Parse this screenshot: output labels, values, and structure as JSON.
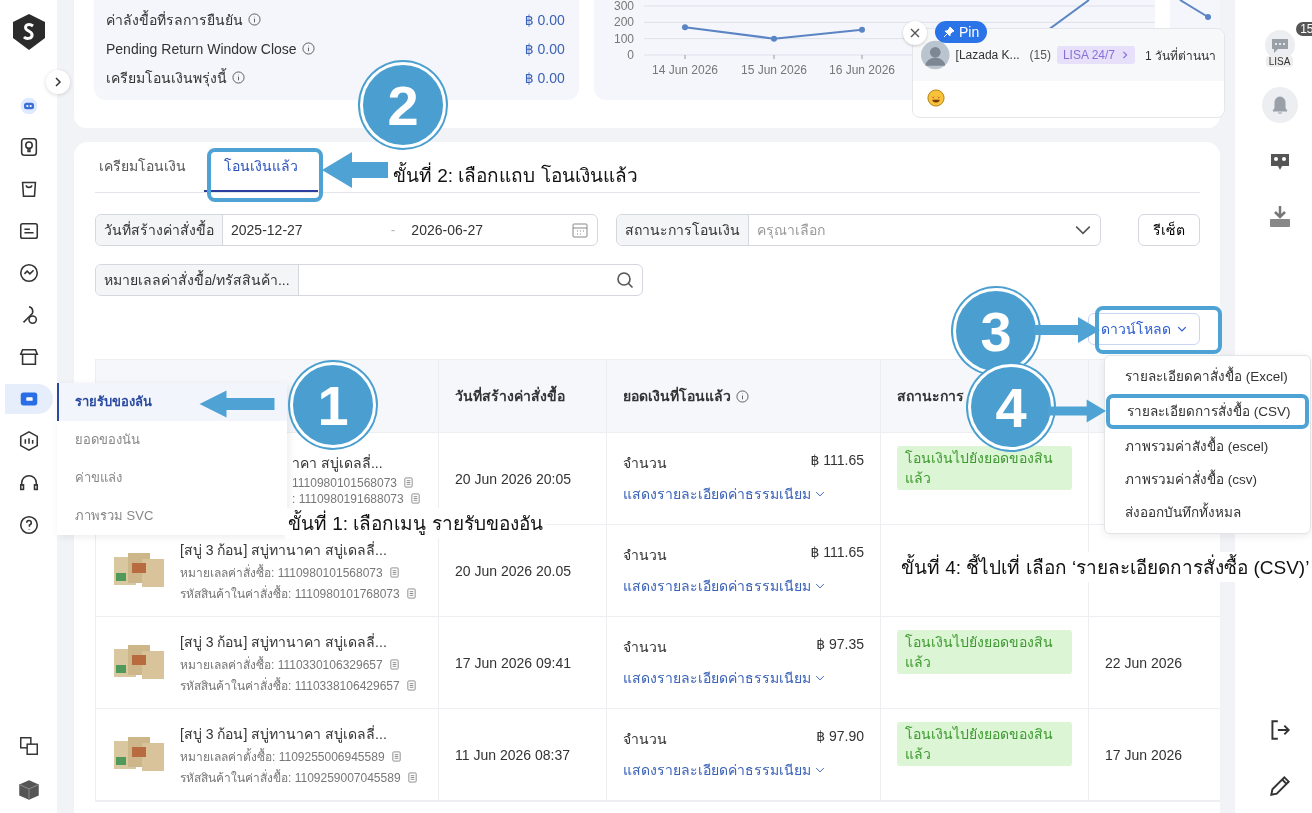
{
  "summary": [
    {
      "label": "ค่าลังขื้อที่รลการยืนยัน",
      "value": "฿ 0.00"
    },
    {
      "label": "Pending Return Window Close",
      "value": "฿ 0.00"
    },
    {
      "label": "เครียมโอนเงินพรุ่งนี้",
      "value": "฿ 0.00"
    }
  ],
  "chart": {
    "chart_data": {
      "type": "line",
      "x": [
        "14 Jun 2026",
        "15 Jun 2026",
        "16 Jun 2026"
      ],
      "series": [
        {
          "color": "#5b84c4",
          "marker": true,
          "values": [
            170,
            100,
            155
          ]
        }
      ],
      "ylim": [
        0,
        300
      ],
      "yticks": [
        0,
        100,
        200,
        300
      ]
    }
  },
  "chat_popup": {
    "pin": "Pin",
    "name": "[Lazada K...",
    "count": "(15)",
    "tag": "LISA 24/7",
    "time": "1 วันที่ต่านนา"
  },
  "tabs": [
    {
      "label": "เครียมโอนเงิน",
      "selected": false
    },
    {
      "label": "โอนเงินแล้ว",
      "selected": true
    }
  ],
  "filters": {
    "date_label": "วันที่สร้างค่าสั่งขื้อ",
    "date_from": "2025-12-27",
    "date_separator": "-",
    "date_to": "2026-06-27",
    "status_label": "สถานะการโอนเงิน",
    "status_placeholder": "ครุณาเลือก",
    "reset": "รีเซ็ต",
    "search_label": "หมายเลลค่าสั่งขื้อ/ทรัสสินค้า..."
  },
  "download": {
    "label": "ดาวน์โหลด",
    "menu": [
      {
        "label": "รายละเอียดคาสั่งขื้อ (Excel)",
        "selected": false
      },
      {
        "label": "รายละเอียดการสั่งขื้อ (CSV)",
        "selected": true
      },
      {
        "label": "ภาพรวมค่าสังขื้อ (escel)",
        "selected": false
      },
      {
        "label": "ภาพรวมค่าสั่งขื้อ (csv)",
        "selected": false
      },
      {
        "label": "ส่งออกบันทึกทั้งหมล",
        "selected": false
      }
    ]
  },
  "table": {
    "columns": [
      {
        "label": "วันที่สร้างค่าสั่งขื้อ",
        "info": false
      },
      {
        "label": "ยอดเงินที่โอนแล้ว",
        "info": true
      },
      {
        "label": "สถานะการ",
        "info": false
      }
    ],
    "rows": [
      {
        "kind": "partial",
        "title": "าคา สบู่เดลลี่...",
        "order_no": "1110980101568073",
        "sku_no": ": 1110980191688073",
        "date": "20 Jun 2026 20:05",
        "amount_label": "จำนวน",
        "amount": "฿ 111.65",
        "fee_link": "แสดงรายละเอียดค่าธรรมเนียม",
        "status": "โอนเงินไปยังยอดของสิน แล้ว"
      },
      {
        "kind": "full",
        "title": "[สบู่ 3 ก้อน] สบู่ทานาคา สบู่เดลลี่...",
        "order_no": "หมายเลลค่าสั่งซื้อ: 1110980101568073",
        "sku_no": "รหัสสินค้าในค่าสั่งซื้อ: 1110980101768073",
        "date": "20 Jun 2026 20.05",
        "amount_label": "จำนวน",
        "amount": "฿ 111.65",
        "fee_link": "แสดงรายละเอียดค่าธรรมเนียม"
      },
      {
        "kind": "full",
        "title": "[สบู่ 3 ก้อน] สบู่ทานาคา สบู่เดลลี่...",
        "order_no": "หมายเลลค่าสั่งซื้อ: 1110330106329657",
        "sku_no": "รหัสสินค้าในค่าสั่งซื้อ: 1110338106429657",
        "date": "17 Jun 2026 09:41",
        "amount_label": "จำนวน",
        "amount": "฿ 97.35",
        "fee_link": "แสดงรายละเอียดค่าธรรมเนียม",
        "status": "โอนเงินไปยังยอดของสิน แล้ว",
        "settled": "22 Jun 2026"
      },
      {
        "kind": "full",
        "title": "[สบู่ 3 ก้อน] สบู่ทานาคา สบู่เดลลี่...",
        "order_no": "หมายเลลค่าตั้งซื้อ: 1109255006945589",
        "sku_no": "รหัสสินค้าในค่าสั่งขื้อ: 1109259007045589",
        "date": "11 Jun 2026 08:37",
        "amount_label": "จำนวน",
        "amount": "฿ 97.90",
        "fee_link": "แสดงรายละเอียดค่าธรรมเนียม",
        "status": "โอนเงินไปยังยอดของสิน แล้ว",
        "settled": "17 Jun 2026"
      }
    ]
  },
  "submenu": [
    {
      "label": "รายรับของลัน",
      "selected": true
    },
    {
      "label": "ยอดของนัน",
      "selected": false
    },
    {
      "label": "ค่าขแล่ง",
      "selected": false
    },
    {
      "label": "ภาพรวม SVC",
      "selected": false
    }
  ],
  "callouts": [
    {
      "number": "1",
      "caption": "ขั้นที่ 1: เลือกเมนู รายรับของอัน"
    },
    {
      "number": "2",
      "caption": "ขั้นที่ 2: เลือกแถบ โอนเงินแล้ว"
    },
    {
      "number": "3"
    },
    {
      "number": "4",
      "caption": "ขั้นที่ 4: ชี้ไปเที่ เลือก ‘รายละเอียดการสั่งซื้อ (CSV)’"
    }
  ],
  "right_rail": {
    "badge": "15",
    "label": "LISA"
  }
}
